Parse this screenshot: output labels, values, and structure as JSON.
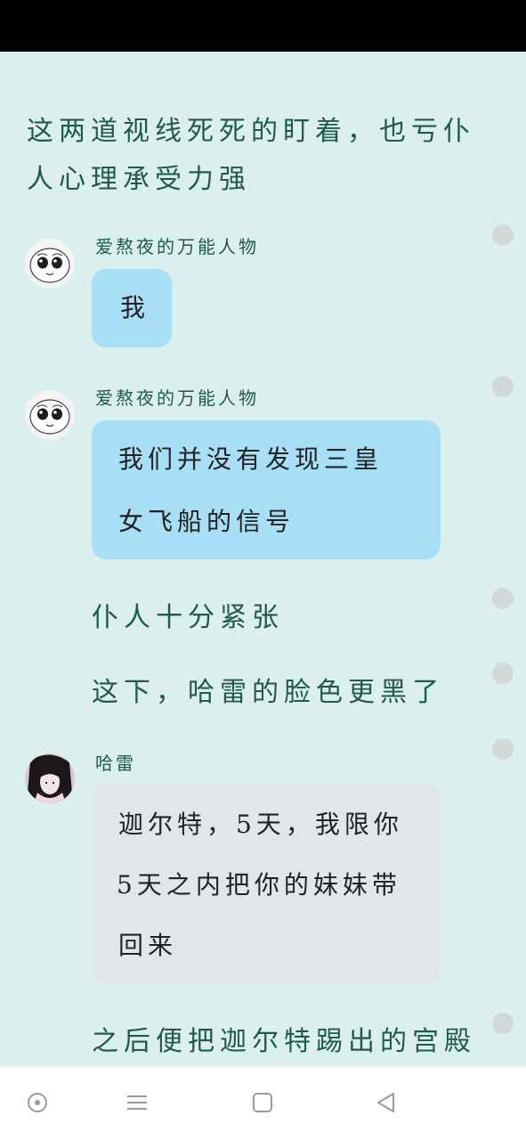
{
  "narration": [
    "这两道视线死死的盯着，也亏仆",
    "人心理承受力强",
    "仆人十分紧张",
    "这下，哈雷的脸色更黑了",
    "之后便把迦尔特踢出的宫殿"
  ],
  "messages": [
    {
      "speaker": "爱熬夜的万能人物",
      "lines": [
        "我"
      ]
    },
    {
      "speaker": "爱熬夜的万能人物",
      "lines": [
        "我们并没有发现三皇",
        "女飞船的信号"
      ]
    },
    {
      "speaker": "哈雷",
      "lines": [
        "迦尔特，5天，我限你",
        "5天之内把你的妹妹带",
        "回来"
      ]
    }
  ],
  "colors": {
    "background": "#dcefef",
    "narration_text": "#1f5b46",
    "bubble_blue": "#a9def7",
    "bubble_grey": "#e1e6ea"
  },
  "nav_icons": [
    "circle-dot-icon",
    "menu-icon",
    "square-icon",
    "back-triangle-icon"
  ]
}
